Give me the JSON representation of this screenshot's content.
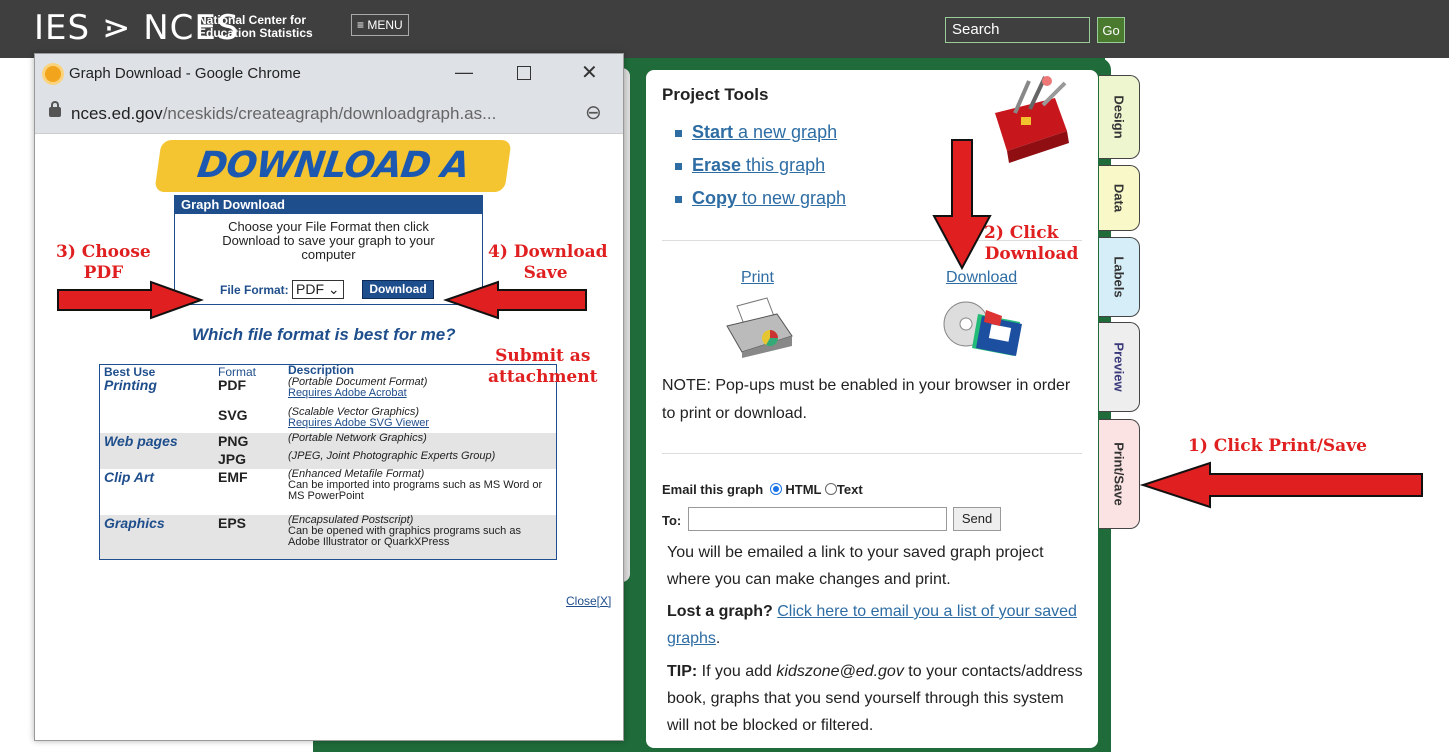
{
  "header": {
    "logo": "IES ⋗ NCES",
    "org_line1": "National Center for",
    "org_line2": "Education Statistics",
    "menu_label": "≡ MENU",
    "search_placeholder": "Search",
    "go_label": "Go"
  },
  "project_tools": {
    "title": "Project Tools",
    "items": [
      {
        "bold": "Start",
        "rest": " a new graph"
      },
      {
        "bold": "Erase",
        "rest": " this graph"
      },
      {
        "bold": "Copy",
        "rest": " to new graph"
      }
    ],
    "print_label": "Print",
    "download_label": "Download",
    "note": "NOTE: Pop-ups must be enabled in your browser in order to print or download."
  },
  "email": {
    "label": "Email this graph",
    "option_html": "HTML",
    "option_text": "Text",
    "to_label": "To:",
    "send_label": "Send",
    "info": "You will be emailed a link to your saved graph project where you can make changes and print.",
    "lost_bold": "Lost a graph?",
    "lost_link": "Click here to email you a list of your saved graphs",
    "lost_end": ".",
    "tip_bold": "TIP:",
    "tip_text1": " If you add ",
    "tip_email": "kidszone@ed.gov",
    "tip_text2": " to your contacts/address book, graphs that you send yourself through this system will not be blocked or filtered."
  },
  "tabs": [
    "Design",
    "Data",
    "Labels",
    "Preview",
    "Print/Save"
  ],
  "popup": {
    "window_title": "Graph Download - Google Chrome",
    "url_domain": "nces.ed.gov",
    "url_path": "/nceskids/createagraph/downloadgraph.as...",
    "banner": "DOWNLOAD A GRAPH",
    "box_title": "Graph Download",
    "box_text": "Choose your File Format then click Download to save your graph to your computer",
    "format_label": "File Format:",
    "format_value": "PDF",
    "download_btn": "Download",
    "which_format": "Which file format is best for me?",
    "table_headers": [
      "Best Use",
      "Format",
      "Description"
    ],
    "rows": [
      {
        "use": "Printing",
        "format": "PDF",
        "desc": "(Portable Document Format)",
        "link": "Requires Adobe Acrobat"
      },
      {
        "use": "",
        "format": "SVG",
        "desc": "(Scalable Vector Graphics)",
        "link": "Requires Adobe SVG Viewer"
      },
      {
        "use": "Web pages",
        "format": "PNG",
        "desc": "(Portable Network Graphics)",
        "link": ""
      },
      {
        "use": "",
        "format": "JPG",
        "desc": "(JPEG, Joint Photographic Experts Group)",
        "link": ""
      },
      {
        "use": "Clip Art",
        "format": "EMF",
        "desc": "(Enhanced Metafile Format)",
        "extra": "Can be imported into programs such as MS Word or MS PowerPoint"
      },
      {
        "use": "Graphics",
        "format": "EPS",
        "desc": "(Encapsulated Postscript)",
        "extra": "Can be opened with graphics programs such as Adobe Illustrator or QuarkXPress"
      }
    ],
    "close_label": "Close[X]"
  },
  "annotations": {
    "a1": "1) Click Print/Save",
    "a2_line1": "2) Click",
    "a2_line2": "Download",
    "a3_line1": "3) Choose",
    "a3_line2": "PDF",
    "a4_line1": "4) Download",
    "a4_line2": "Save",
    "a5_line1": "Submit as",
    "a5_line2": "attachment"
  },
  "colors": {
    "annotation_red": "#e02020",
    "link_blue": "#2e6da4",
    "panel_green": "#1f6b3a",
    "nces_blue": "#1f4e8c"
  }
}
